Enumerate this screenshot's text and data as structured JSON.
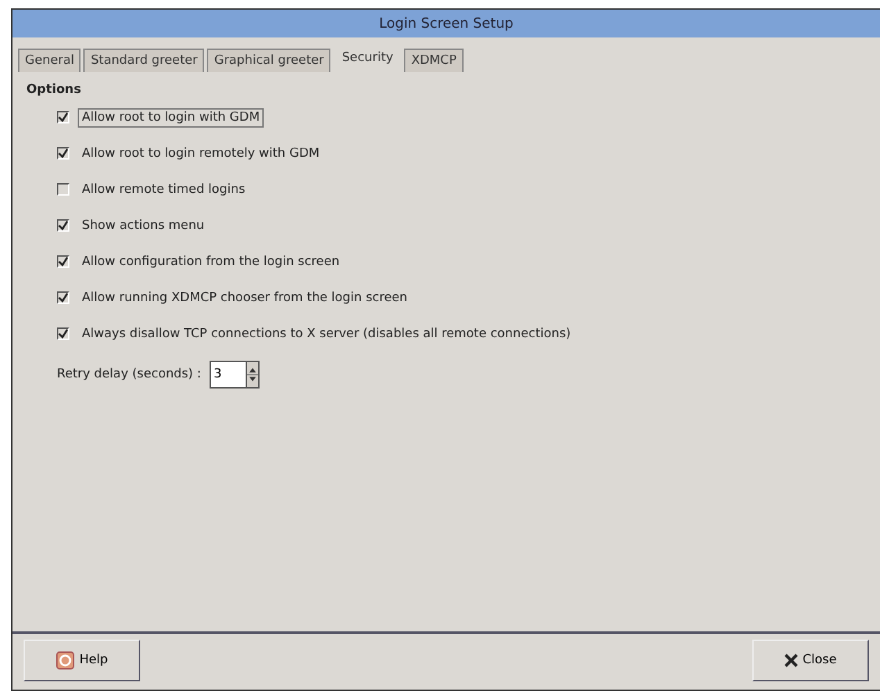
{
  "window": {
    "title": "Login Screen Setup"
  },
  "tabs": [
    {
      "label": "General",
      "selected": false
    },
    {
      "label": "Standard greeter",
      "selected": false
    },
    {
      "label": "Graphical greeter",
      "selected": false
    },
    {
      "label": "Security",
      "selected": true
    },
    {
      "label": "XDMCP",
      "selected": false
    }
  ],
  "section": "Options",
  "options": [
    {
      "label": "Allow root to login with GDM",
      "checked": true,
      "focused": true
    },
    {
      "label": "Allow root to login remotely with GDM",
      "checked": true,
      "focused": false
    },
    {
      "label": "Allow remote timed logins",
      "checked": false,
      "focused": false
    },
    {
      "label": "Show actions menu",
      "checked": true,
      "focused": false
    },
    {
      "label": "Allow configuration from the login screen",
      "checked": true,
      "focused": false
    },
    {
      "label": "Allow running XDMCP chooser from the login screen",
      "checked": true,
      "focused": false
    },
    {
      "label": "Always disallow TCP connections to X server (disables all remote connections)",
      "checked": true,
      "focused": false
    }
  ],
  "retry": {
    "label": "Retry delay (seconds) :",
    "value": "3"
  },
  "buttons": {
    "help": "Help",
    "close": "Close"
  }
}
